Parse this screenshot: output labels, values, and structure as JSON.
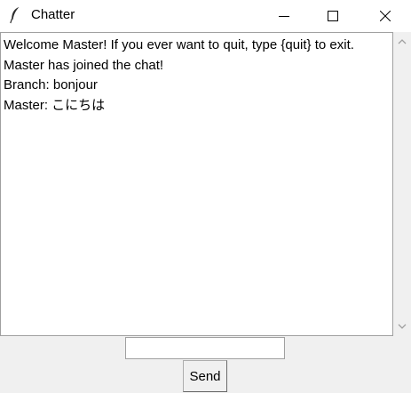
{
  "window": {
    "title": "Chatter",
    "icon": "feather-icon",
    "controls": [
      "minimize-icon",
      "maximize-icon",
      "close-icon"
    ]
  },
  "chat": {
    "lines": [
      "Welcome Master! If you ever want to quit, type {quit} to exit.",
      "Master has joined the chat!",
      "Branch: bonjour",
      "Master: こにちは"
    ]
  },
  "input": {
    "value": "",
    "placeholder": ""
  },
  "send_button": {
    "label": "Send"
  }
}
